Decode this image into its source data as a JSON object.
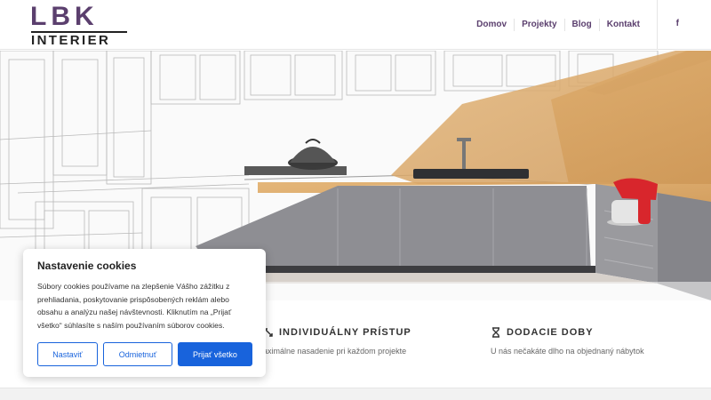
{
  "logo": {
    "top": "LBK",
    "bottom": "INTERIER"
  },
  "nav": {
    "items": [
      "Domov",
      "Projekty",
      "Blog",
      "Kontakt"
    ],
    "social": "f"
  },
  "features": [
    {
      "title": "INDIVIDUÁLNY PRÍSTUP",
      "desc": "aximálne nasadenie pri každom projekte",
      "icon": "arrows-icon"
    },
    {
      "title": "DODACIE DOBY",
      "desc": "U nás nečakáte dlho na objednaný nábytok",
      "icon": "hourglass-icon"
    }
  ],
  "cookie": {
    "title": "Nastavenie cookies",
    "text": "Súbory cookies používame na zlepšenie Vášho zážitku z prehliadania, poskytovanie prispôsobených reklám alebo obsahu a analýzu našej návštevnosti. Kliknutím na „Prijať všetko“ súhlasíte s naším používaním súborov cookies.",
    "buttons": {
      "settings": "Nastaviť",
      "reject": "Odmietnuť",
      "accept": "Prijať všetko"
    }
  },
  "colors": {
    "brand": "#5b3f6e",
    "accent": "#1863dc"
  }
}
